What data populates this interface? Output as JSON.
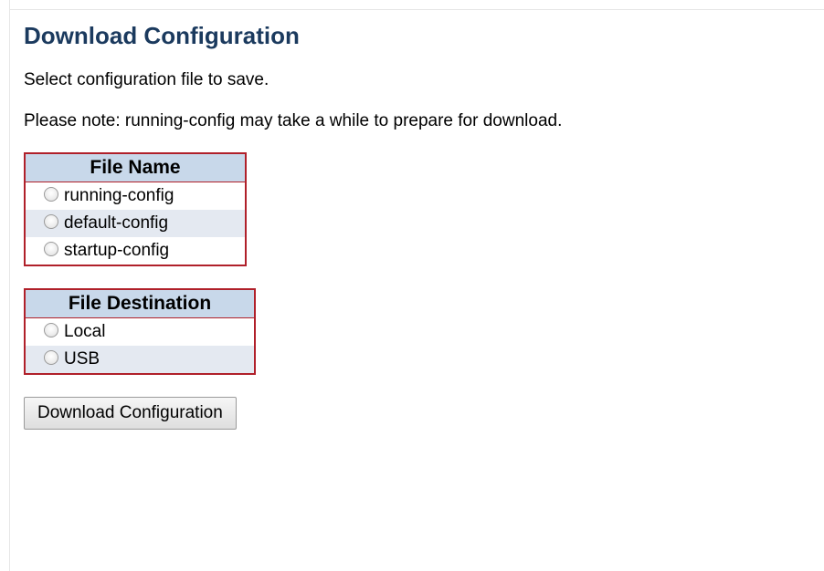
{
  "page": {
    "title": "Download Configuration",
    "instruction": "Select configuration file to save.",
    "note": "Please note: running-config may take a while to prepare for download."
  },
  "file_name_table": {
    "header": "File Name",
    "options": [
      "running-config",
      "default-config",
      "startup-config"
    ]
  },
  "file_destination_table": {
    "header": "File Destination",
    "options": [
      "Local",
      "USB"
    ]
  },
  "actions": {
    "download_label": "Download Configuration"
  },
  "colors": {
    "heading": "#1b3a5e",
    "table_border": "#b0202a",
    "table_header_bg": "#c8d8ea",
    "row_alt_bg": "#e4e9f1"
  }
}
